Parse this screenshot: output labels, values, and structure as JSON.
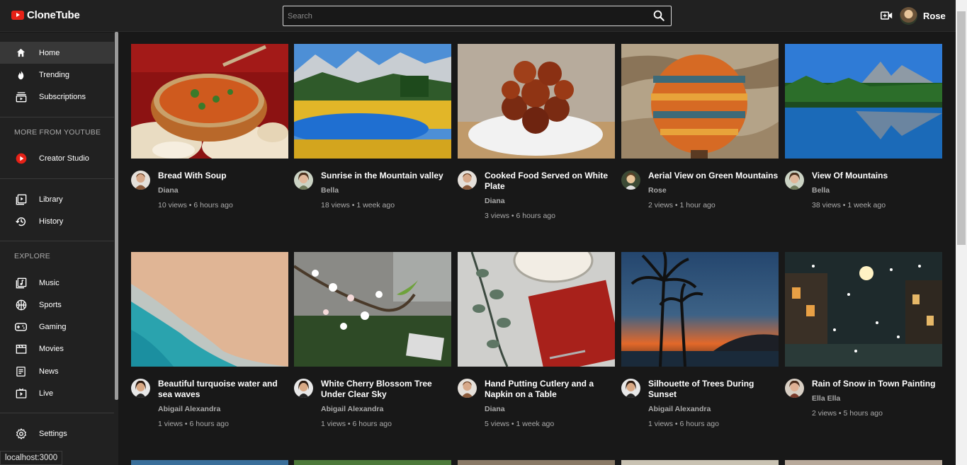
{
  "app": {
    "name": "CloneTube"
  },
  "search": {
    "placeholder": "Search"
  },
  "user": {
    "name": "Rose"
  },
  "sidebar": {
    "main": [
      {
        "label": "Home",
        "icon": "home-icon",
        "active": true
      },
      {
        "label": "Trending",
        "icon": "fire-icon"
      },
      {
        "label": "Subscriptions",
        "icon": "subscriptions-icon"
      }
    ],
    "more_heading": "MORE FROM YOUTUBE",
    "more": [
      {
        "label": "Creator Studio",
        "icon": "creator-studio-icon"
      }
    ],
    "library": [
      {
        "label": "Library",
        "icon": "library-icon"
      },
      {
        "label": "History",
        "icon": "history-icon"
      }
    ],
    "explore_heading": "EXPLORE",
    "explore": [
      {
        "label": "Music",
        "icon": "music-icon"
      },
      {
        "label": "Sports",
        "icon": "sports-icon"
      },
      {
        "label": "Gaming",
        "icon": "gaming-icon"
      },
      {
        "label": "Movies",
        "icon": "movies-icon"
      },
      {
        "label": "News",
        "icon": "news-icon"
      },
      {
        "label": "Live",
        "icon": "live-icon"
      }
    ],
    "settings": {
      "label": "Settings",
      "icon": "gear-icon"
    }
  },
  "status_bar": {
    "url": "localhost:3000"
  },
  "videos": [
    {
      "title": "Bread With Soup",
      "channel": "Diana",
      "stats": "10 views • 6 hours ago"
    },
    {
      "title": "Sunrise in the Mountain valley",
      "channel": "Bella",
      "stats": "18 views • 1 week ago"
    },
    {
      "title": "Cooked Food Served on White Plate",
      "channel": "Diana",
      "stats": "3 views • 6 hours ago"
    },
    {
      "title": "Aerial View on Green Mountains",
      "channel": "Rose",
      "stats": "2 views • 1 hour ago"
    },
    {
      "title": "View Of Mountains",
      "channel": "Bella",
      "stats": "38 views • 1 week ago"
    },
    {
      "title": "Beautiful turquoise water and sea waves",
      "channel": "Abigail Alexandra",
      "stats": "1 views • 6 hours ago"
    },
    {
      "title": "White Cherry Blossom Tree Under Clear Sky",
      "channel": "Abigail Alexandra",
      "stats": "1 views • 6 hours ago"
    },
    {
      "title": "Hand Putting Cutlery and a Napkin on a Table",
      "channel": "Diana",
      "stats": "5 views • 1 week ago"
    },
    {
      "title": "Silhouette of Trees During Sunset",
      "channel": "Abigail Alexandra",
      "stats": "1 views • 6 hours ago"
    },
    {
      "title": "Rain of Snow in Town Painting",
      "channel": "Ella Ella",
      "stats": "2 views • 5 hours ago"
    }
  ]
}
